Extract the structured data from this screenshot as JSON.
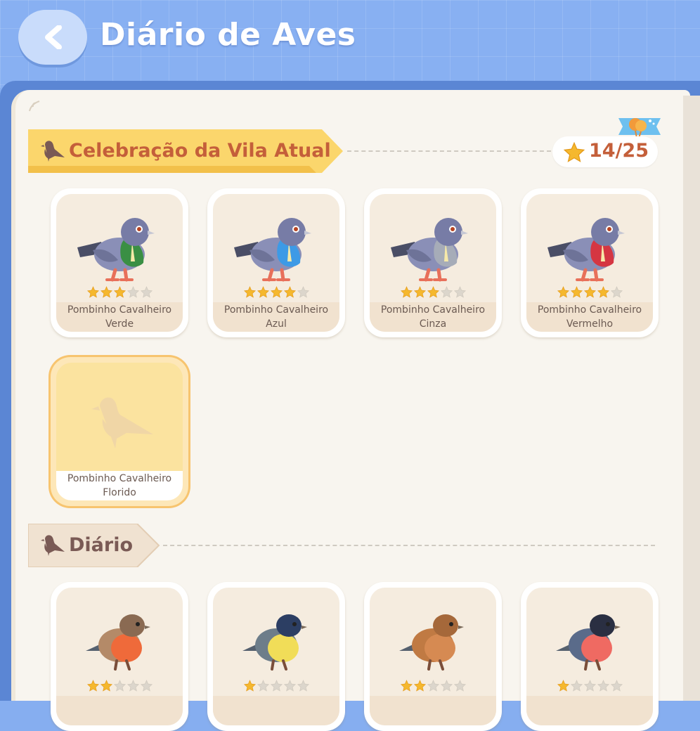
{
  "header": {
    "title": "Diário de Aves"
  },
  "colors": {
    "accent": "#c45f3a",
    "banner": "#fbd66c",
    "star_on": "#f5b82e",
    "star_off": "#dcd6cc"
  },
  "sections": [
    {
      "label": "Celebração da Vila Atual",
      "icon": "bird-silhouette-icon",
      "progress": "14/25",
      "badge_icon": "balloon-icon"
    },
    {
      "label": "Diário",
      "icon": "bird-silhouette-icon"
    }
  ],
  "celebration_birds": [
    {
      "name_line1": "Pombinho Cavalheiro",
      "name_line2": "Verde",
      "stars": 3,
      "vest": "#3a8f44"
    },
    {
      "name_line1": "Pombinho Cavalheiro",
      "name_line2": "Azul",
      "stars": 4,
      "vest": "#3d9ae6"
    },
    {
      "name_line1": "Pombinho Cavalheiro",
      "name_line2": "Cinza",
      "stars": 3,
      "vest": "#a6acb8"
    },
    {
      "name_line1": "Pombinho Cavalheiro",
      "name_line2": "Vermelho",
      "stars": 4,
      "vest": "#d53642"
    },
    {
      "name_line1": "Pombinho Cavalheiro",
      "name_line2": "Florido",
      "stars": 0,
      "locked": true
    }
  ],
  "diary_birds": [
    {
      "stars": 2,
      "kind": "robin-icon"
    },
    {
      "stars": 1,
      "kind": "blue-tit-icon"
    },
    {
      "stars": 2,
      "kind": "sparrow-icon"
    },
    {
      "stars": 1,
      "kind": "bullfinch-icon"
    }
  ]
}
